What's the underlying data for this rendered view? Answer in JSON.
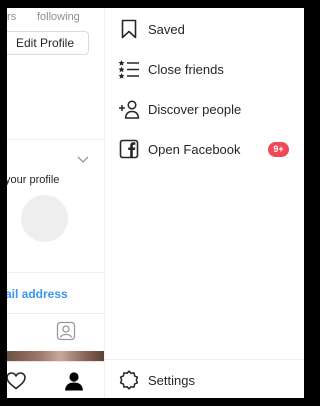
{
  "profile": {
    "followers_label": "wers",
    "following_label": "following",
    "edit_profile_label": "Edit Profile",
    "your_profile_text": "your profile",
    "email_link_text": "ail address"
  },
  "drawer": {
    "items": [
      {
        "label": "Saved",
        "icon": "bookmark-icon"
      },
      {
        "label": "Close friends",
        "icon": "close-friends-list-icon"
      },
      {
        "label": "Discover people",
        "icon": "add-person-icon"
      },
      {
        "label": "Open Facebook",
        "icon": "facebook-icon",
        "badge": "9+"
      }
    ],
    "settings": {
      "label": "Settings",
      "icon": "settings-gear-icon"
    }
  },
  "colors": {
    "link": "#3897f0",
    "badge": "#ed4956",
    "text": "#262626",
    "muted": "#8e8e8e"
  }
}
